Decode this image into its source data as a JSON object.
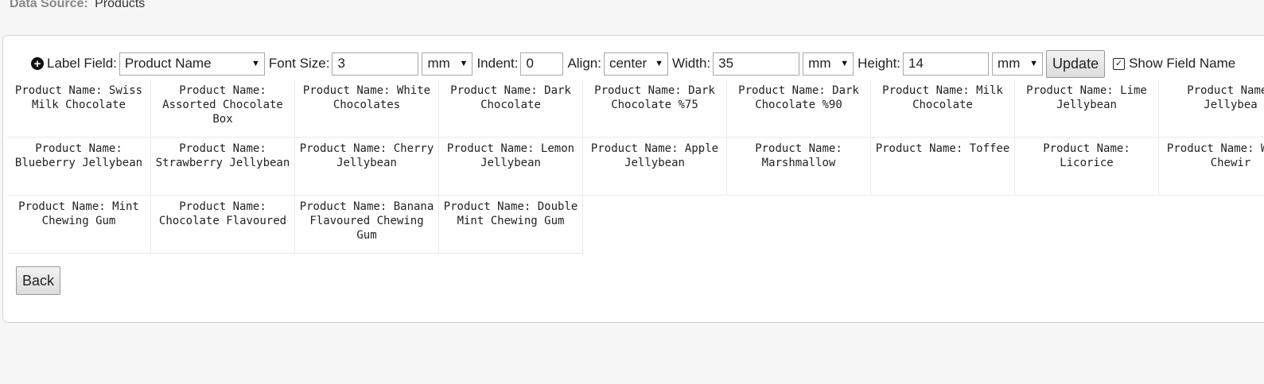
{
  "data_source": {
    "label": "Data Source:",
    "value": "Products"
  },
  "toolbar": {
    "label_field_label": "Label Field:",
    "label_field_value": "Product Name",
    "font_size_label": "Font Size:",
    "font_size_value": "3",
    "font_size_unit": "mm",
    "indent_label": "Indent:",
    "indent_value": "0",
    "align_label": "Align:",
    "align_value": "center",
    "width_label": "Width:",
    "width_value": "35",
    "width_unit": "mm",
    "height_label": "Height:",
    "height_value": "14",
    "height_unit": "mm",
    "update_label": "Update",
    "show_field_name_label": "Show Field Name",
    "show_field_name_checked": true
  },
  "labels": [
    "Product Name: Swiss Milk Chocolate",
    "Product Name: Assorted Chocolate Box",
    "Product Name: White Chocolates",
    "Product Name: Dark Chocolate",
    "Product Name: Dark Chocolate %75",
    "Product Name: Dark Chocolate %90",
    "Product Name: Milk Chocolate",
    "Product Name: Lime Jellybean",
    "Product Name: Jellybea",
    "Product Name: Blueberry Jellybean",
    "Product Name: Strawberry Jellybean",
    "Product Name: Cherry Jellybean",
    "Product Name: Lemon Jellybean",
    "Product Name: Apple Jellybean",
    "Product Name: Marshmallow",
    "Product Name: Toffee",
    "Product Name: Licorice",
    "Product Name: White Chewir",
    "Product Name: Mint Chewing Gum",
    "Product Name: Chocolate Flavoured",
    "Product Name: Banana Flavoured Chewing Gum",
    "Product Name: Double Mint Chewing Gum"
  ],
  "back_label": "Back"
}
